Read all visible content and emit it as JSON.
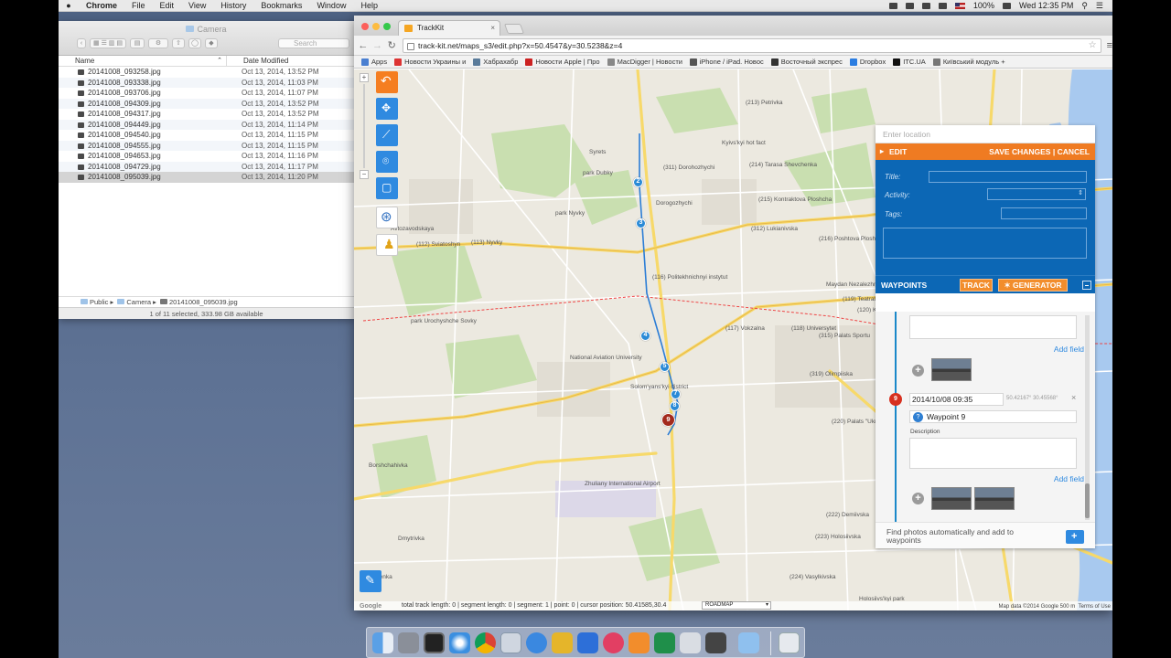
{
  "menubar": {
    "items": [
      "Chrome",
      "File",
      "Edit",
      "View",
      "History",
      "Bookmarks",
      "Window",
      "Help"
    ],
    "battery": "100%",
    "clock": "Wed 12:35 PM"
  },
  "finder": {
    "title": "Camera",
    "search_placeholder": "Search",
    "columns": [
      "Name",
      "Date Modified"
    ],
    "files": [
      {
        "name": "20141008_093258.jpg",
        "date": "Oct 13, 2014, 13:52 PM"
      },
      {
        "name": "20141008_093338.jpg",
        "date": "Oct 13, 2014, 11:03 PM"
      },
      {
        "name": "20141008_093706.jpg",
        "date": "Oct 13, 2014, 11:07 PM"
      },
      {
        "name": "20141008_094309.jpg",
        "date": "Oct 13, 2014, 13:52 PM"
      },
      {
        "name": "20141008_094317.jpg",
        "date": "Oct 13, 2014, 13:52 PM"
      },
      {
        "name": "20141008_094449.jpg",
        "date": "Oct 13, 2014, 11:14 PM"
      },
      {
        "name": "20141008_094540.jpg",
        "date": "Oct 13, 2014, 11:15 PM"
      },
      {
        "name": "20141008_094555.jpg",
        "date": "Oct 13, 2014, 11:15 PM"
      },
      {
        "name": "20141008_094653.jpg",
        "date": "Oct 13, 2014, 11:16 PM"
      },
      {
        "name": "20141008_094729.jpg",
        "date": "Oct 13, 2014, 11:17 PM"
      },
      {
        "name": "20141008_095039.jpg",
        "date": "Oct 13, 2014, 11:20 PM"
      }
    ],
    "path": [
      "Public",
      "Camera",
      "20141008_095039.jpg"
    ],
    "status": "1 of 11 selected, 333.98 GB available"
  },
  "browser": {
    "tab_title": "TrackKit",
    "url": "track-kit.net/maps_s3/edit.php?x=50.4547&y=30.5238&z=4",
    "bookmarks": [
      {
        "label": "Apps",
        "color": "#4a7fd1"
      },
      {
        "label": "Новости Украины и",
        "color": "#d33"
      },
      {
        "label": "Хабрахабр",
        "color": "#5a7b9a"
      },
      {
        "label": "Новости Apple | Про",
        "color": "#c22"
      },
      {
        "label": "MacDigger | Новости",
        "color": "#888"
      },
      {
        "label": "iPhone / iPad. Новос",
        "color": "#555"
      },
      {
        "label": "Восточный экспрес",
        "color": "#333"
      },
      {
        "label": "Dropbox",
        "color": "#2b7de1"
      },
      {
        "label": "ITC.UA",
        "color": "#111"
      },
      {
        "label": "Київський модуль +",
        "color": "#777"
      }
    ]
  },
  "map": {
    "labels": [
      "(213) Petrivka",
      "Kyivs'kyi hot fact",
      "(214) Tarasa Shevchenka",
      "(215) Kontraktova Ploshcha",
      "(311) Dorohozhychi",
      "Syrets",
      "park Dubky",
      "park Nyvky",
      "Dorogozhychi",
      "(312) Lukianivska",
      "(112) Sviatoshyn",
      "(113) Nyvky",
      "Avtozavodskaya",
      "(116) Politekhnichnyi instytut",
      "(117) Vokzalna",
      "(118) Universytet",
      "(315) Palats Sportu",
      "Maydan Nezalezhnosti",
      "(119) Teatralna",
      "(120) Khreshchatyk",
      "(216) Poshtova Ploshcha",
      "National Aviation University",
      "Solom'yans'kyi district",
      "park Urochyshche Sovky",
      "(319) Olimpiiska",
      "(220) Palats \"Ukraina\"",
      "Zhuliany International Airport",
      "Borshchahivka",
      "(222) Demiivska",
      "(223) Holosiivska",
      "(224) Vasylkivska",
      "(319) Vydubychi",
      "Dmytrivka",
      "Holosiivs'kyi park",
      "Shevchenka"
    ],
    "markers": [
      "2",
      "3",
      "4",
      "5",
      "7",
      "8",
      "9"
    ],
    "statusbar": "total track length: 0 | segment length: 0 | segment: 1 | point: 0 | cursor position: 50.41585,30.4",
    "maptype": "ROADMAP",
    "google": "Google",
    "copyright": "Map data ©2014 Google   500 m",
    "terms": "Terms of Use"
  },
  "panel": {
    "location_placeholder": "Enter location",
    "edit_label": "EDIT",
    "save_label": "SAVE CHANGES",
    "cancel_label": "CANCEL",
    "fields": {
      "title": "Title:",
      "activity": "Activity:",
      "tags": "Tags:"
    },
    "waypoints_label": "WAYPOINTS",
    "track_label": "TRACK",
    "generator_label": "GENERATOR",
    "add_field": "Add field",
    "waypoint": {
      "number": "9",
      "datetime": "2014/10/08 09:35",
      "coords": "50.42167° 30.45568°",
      "name": "Waypoint 9",
      "description_label": "Description"
    },
    "find_text_1": "Find photos automatically and add to",
    "find_text_2": "waypoints"
  },
  "colors": {
    "accent_orange": "#ef7b22",
    "panel_blue": "#0c67b5",
    "marker_blue": "#2a8ad6",
    "marker_red": "#a32a1d"
  }
}
